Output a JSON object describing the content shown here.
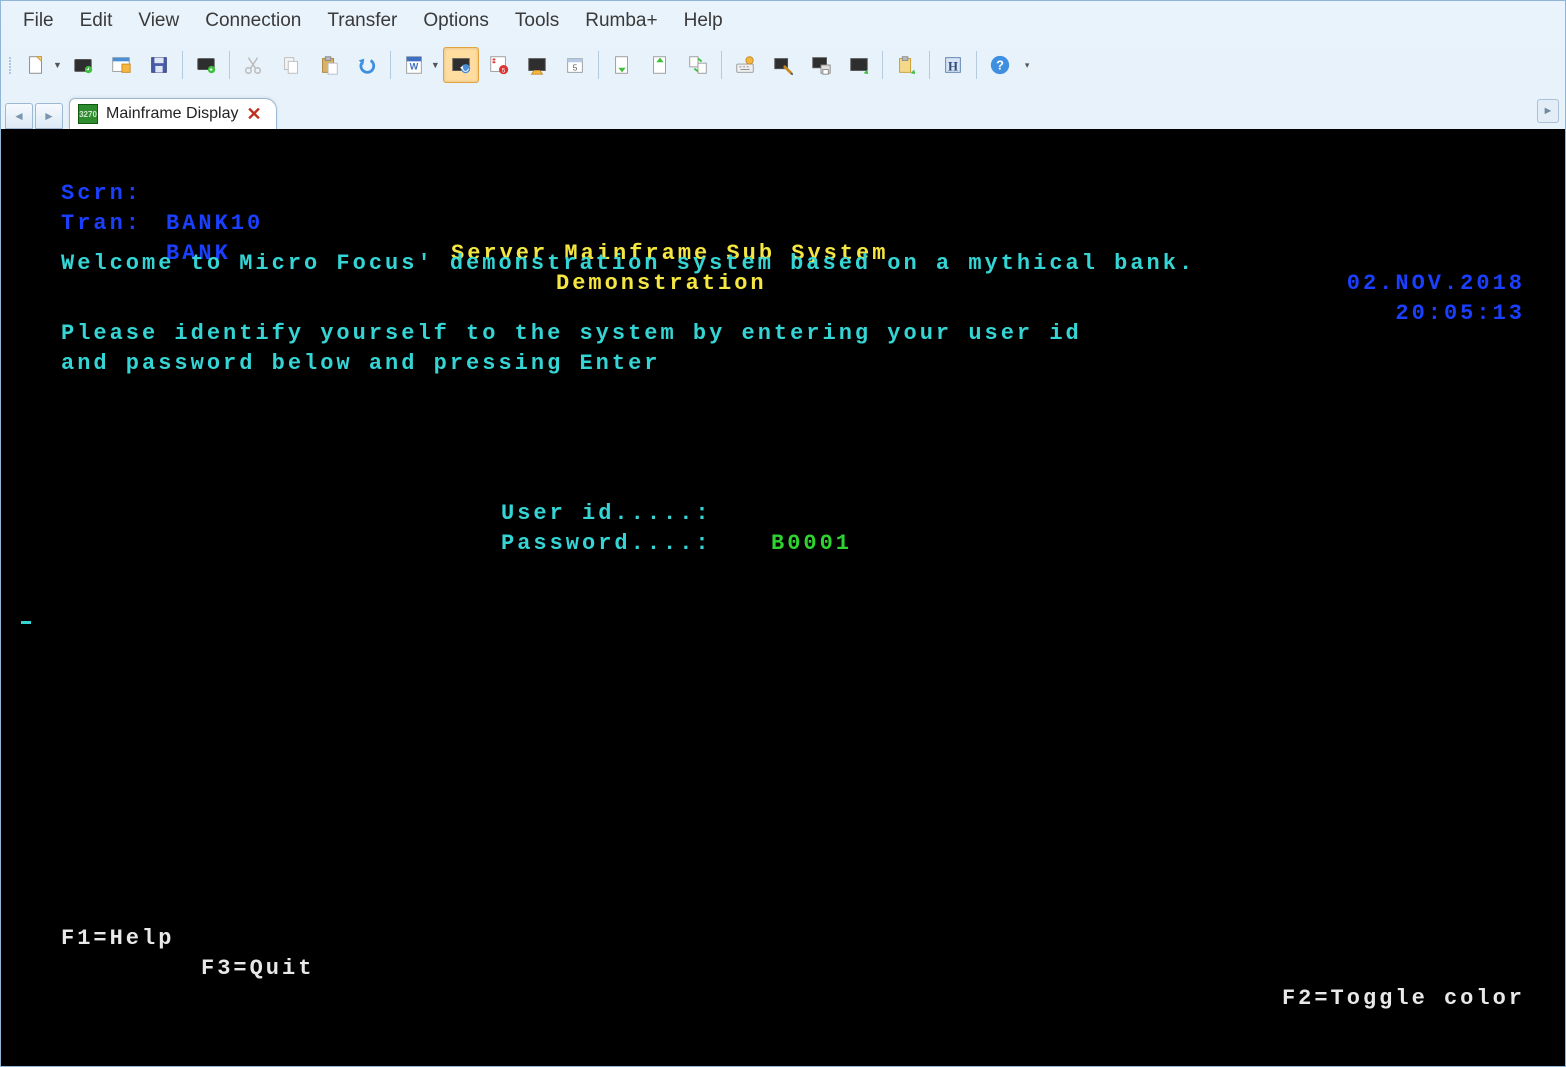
{
  "menu": {
    "file": "File",
    "edit": "Edit",
    "view": "View",
    "connection": "Connection",
    "transfer": "Transfer",
    "options": "Options",
    "tools": "Tools",
    "rumba": "Rumba+",
    "help": "Help"
  },
  "toolbar_icons": {
    "new": "new-document-icon",
    "open": "open-session-icon",
    "recent": "recent-icon",
    "save": "save-icon",
    "connect": "connect-icon",
    "cut": "cut-icon",
    "copy": "copy-icon",
    "paste": "paste-icon",
    "undo": "undo-icon",
    "word": "word-export-icon",
    "run": "run-macro-icon",
    "record": "record-macro-icon",
    "macro": "macro-icon",
    "schedule": "schedule-icon",
    "send": "file-send-icon",
    "receive": "file-receive-icon",
    "transfer": "transfer-icon",
    "keymap": "keyboard-map-icon",
    "screendesign": "screen-designer-icon",
    "printscreen": "print-screen-icon",
    "capture": "capture-icon",
    "clipboard": "clipboard-icon",
    "history": "history-icon",
    "helpbtn": "help-icon"
  },
  "tab": {
    "title": "Mainframe Display"
  },
  "screen": {
    "scrn_label": "Scrn:",
    "scrn_value": "BANK10",
    "tran_label": "Tran:",
    "tran_value": "BANK",
    "title1": "Server Mainframe Sub System",
    "title2": "Demonstration",
    "date": "02.NOV.2018",
    "time": "20:05:13",
    "welcome": "Welcome to Micro Focus' demonstration system based on a mythical bank.",
    "instr1": "Please identify yourself to the system by entering your user id",
    "instr2": "and password below and pressing Enter",
    "userid_label": "User id.....:",
    "userid_value": "B0001",
    "password_label": "Password....:",
    "password_value": "",
    "f1": "F1=Help",
    "f3": "F3=Quit",
    "f2": "F2=Toggle color"
  }
}
